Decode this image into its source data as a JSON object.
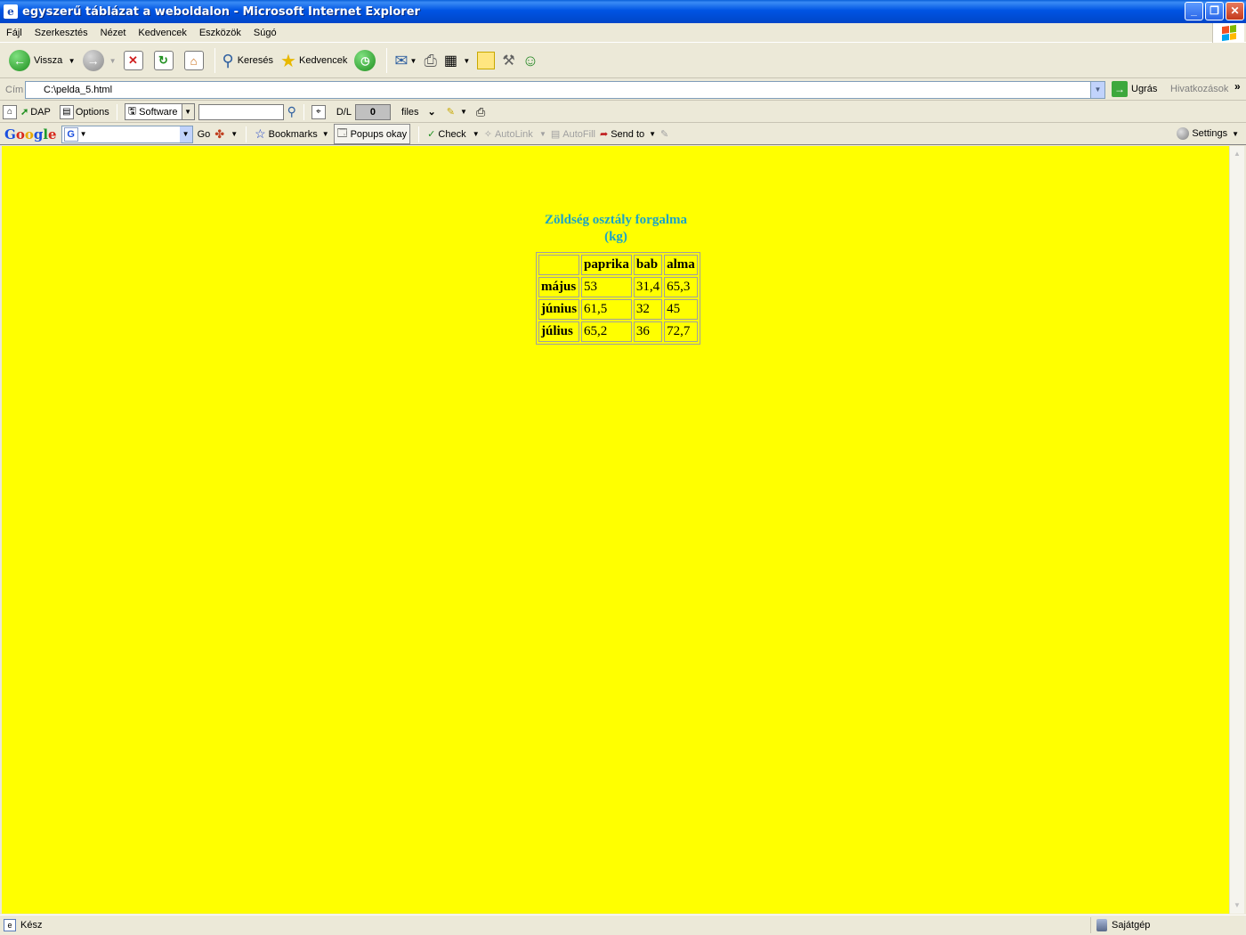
{
  "window": {
    "title": "egyszerű táblázat a weboldalon - Microsoft Internet Explorer"
  },
  "menu": [
    "Fájl",
    "Szerkesztés",
    "Nézet",
    "Kedvencek",
    "Eszközök",
    "Súgó"
  ],
  "toolbar": {
    "back_label": "Vissza",
    "search_label": "Keresés",
    "favorites_label": "Kedvencek"
  },
  "address": {
    "label": "Cím",
    "url": "C:\\pelda_5.html",
    "go_label": "Ugrás",
    "links_label": "Hivatkozások"
  },
  "extrabar": {
    "dap_label": "DAP",
    "options_label": "Options",
    "software_label": "Software",
    "dl_label": "D/L",
    "dl_count": "0",
    "files_label": "files"
  },
  "googlebar": {
    "go_label": "Go",
    "bookmarks_label": "Bookmarks",
    "popups_label": "Popups okay",
    "check_label": "Check",
    "autolink_label": "AutoLink",
    "autofill_label": "AutoFill",
    "sendto_label": "Send to",
    "settings_label": "Settings"
  },
  "page": {
    "title_line1": "Zöldség osztály forgalma",
    "title_line2": "(kg)",
    "title_color": "#1aa3c8",
    "background": "#ffff00",
    "table": {
      "headers": [
        "",
        "paprika",
        "bab",
        "alma"
      ],
      "rows": [
        [
          "május",
          "53",
          "31,4",
          "65,3"
        ],
        [
          "június",
          "61,5",
          "32",
          "45"
        ],
        [
          "július",
          "65,2",
          "36",
          "72,7"
        ]
      ]
    }
  },
  "status": {
    "text": "Kész",
    "zone": "Sajátgép"
  }
}
